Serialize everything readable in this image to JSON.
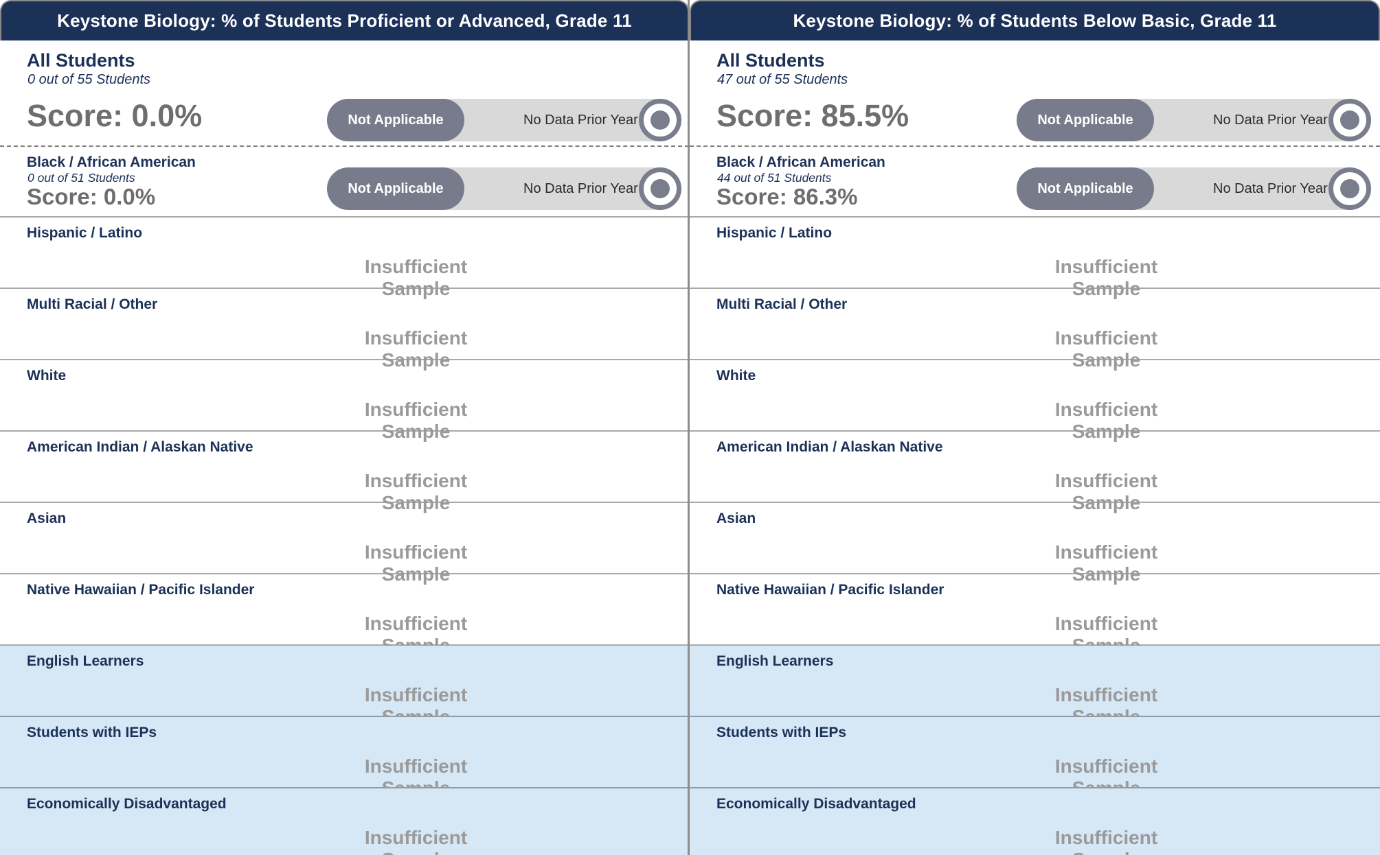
{
  "panels": [
    {
      "title": "Keystone Biology: % of Students Proficient or Advanced, Grade 11",
      "all_students": {
        "label": "All Students",
        "count": "0 out of 55 Students",
        "score": "Score: 0.0%",
        "status": "Not Applicable",
        "prior_year": "No Data Prior Year"
      },
      "black": {
        "label": "Black / African American",
        "count": "0 out of 51 Students",
        "score": "Score: 0.0%",
        "status": "Not Applicable",
        "prior_year": "No Data Prior Year"
      },
      "groups": [
        {
          "label": "Hispanic / Latino",
          "value": "Insufficient Sample"
        },
        {
          "label": "Multi Racial / Other",
          "value": "Insufficient Sample"
        },
        {
          "label": "White",
          "value": "Insufficient Sample"
        },
        {
          "label": "American Indian / Alaskan Native",
          "value": "Insufficient Sample"
        },
        {
          "label": "Asian",
          "value": "Insufficient Sample"
        },
        {
          "label": "Native Hawaiian / Pacific Islander",
          "value": "Insufficient Sample"
        },
        {
          "label": "English Learners",
          "value": "Insufficient Sample"
        },
        {
          "label": "Students with IEPs",
          "value": "Insufficient Sample"
        },
        {
          "label": "Economically Disadvantaged",
          "value": "Insufficient Sample"
        }
      ]
    },
    {
      "title": "Keystone Biology: % of Students Below Basic, Grade 11",
      "all_students": {
        "label": "All Students",
        "count": "47 out of 55 Students",
        "score": "Score: 85.5%",
        "status": "Not Applicable",
        "prior_year": "No Data Prior Year"
      },
      "black": {
        "label": "Black / African American",
        "count": "44 out of 51 Students",
        "score": "Score: 86.3%",
        "status": "Not Applicable",
        "prior_year": "No Data Prior Year"
      },
      "groups": [
        {
          "label": "Hispanic / Latino",
          "value": "Insufficient Sample"
        },
        {
          "label": "Multi Racial / Other",
          "value": "Insufficient Sample"
        },
        {
          "label": "White",
          "value": "Insufficient Sample"
        },
        {
          "label": "American Indian / Alaskan Native",
          "value": "Insufficient Sample"
        },
        {
          "label": "Asian",
          "value": "Insufficient Sample"
        },
        {
          "label": "Native Hawaiian / Pacific Islander",
          "value": "Insufficient Sample"
        },
        {
          "label": "English Learners",
          "value": "Insufficient Sample"
        },
        {
          "label": "Students with IEPs",
          "value": "Insufficient Sample"
        },
        {
          "label": "Economically Disadvantaged",
          "value": "Insufficient Sample"
        }
      ]
    }
  ],
  "colors": {
    "header_bg": "#1c3157",
    "shaded_row_bg": "#d6e7f6",
    "score_text": "#6e6e6e",
    "status_pill": "#787b8b",
    "insufficient_text": "#9a9a9a"
  }
}
